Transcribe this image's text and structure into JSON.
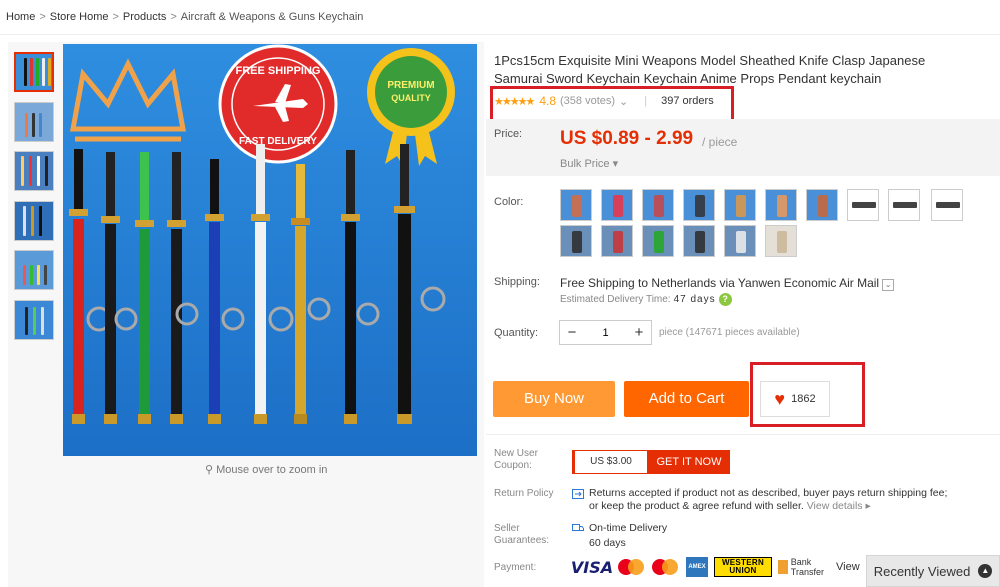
{
  "breadcrumb": [
    {
      "label": "Home"
    },
    {
      "label": "Store Home"
    },
    {
      "label": "Products"
    },
    {
      "label": "Aircraft & Weapons & Guns Keychain"
    }
  ],
  "breadcrumb_sep": ">",
  "gallery": {
    "thumbnail_count": 6,
    "zoom_hint": "Mouse over to zoom in",
    "image_badges": {
      "shipping_line1": "FREE SHIPPING",
      "shipping_line2": "FAST DELIVERY",
      "quality_line1": "PREMIUM",
      "quality_line2": "QUALITY"
    }
  },
  "product": {
    "title": "1Pcs15cm Exquisite Mini Weapons Model Sheathed Knife Clasp Japanese Samurai Sword Keychain Keychain Anime Props Pendant keychain",
    "stars": "★★★★★",
    "rating": "4.8",
    "votes": "(358 votes)",
    "votes_caret": "⌄",
    "orders": "397 orders"
  },
  "price": {
    "label": "Price:",
    "value": "US $0.89 - 2.99",
    "unit": "/ piece",
    "bulk": "Bulk Price ▾"
  },
  "color": {
    "label": "Color:",
    "swatch_count": 15
  },
  "shipping": {
    "label": "Shipping:",
    "line_prefix": "Free Shipping",
    "line_to": " to ",
    "country": "Netherlands",
    "line_via": " via Yanwen Economic Air Mail",
    "dropdown": "⌄",
    "est_label": "Estimated Delivery Time:",
    "est_value": "47 days",
    "help": "?"
  },
  "quantity": {
    "label": "Quantity:",
    "minus": "−",
    "value": "1",
    "plus": "+",
    "note": "piece (147671 pieces available)"
  },
  "actions": {
    "buy_now": "Buy Now",
    "add_to_cart": "Add to Cart",
    "wishlist_count": "1862",
    "heart": "♥"
  },
  "coupon": {
    "label": "New User Coupon:",
    "amount": "US $3.00",
    "button": "GET IT NOW"
  },
  "return_policy": {
    "label": "Return Policy",
    "text": "Returns accepted if product not as described, buyer pays return shipping fee; or keep the product & agree refund with seller.",
    "link": "View details ▸"
  },
  "seller_guarantees": {
    "label": "Seller Guarantees:",
    "line1": "On-time Delivery",
    "line2": "60 days"
  },
  "payment": {
    "label": "Payment:",
    "visa": "VISA",
    "amex": "AMEX",
    "western_union": "WESTERN UNION",
    "bank_transfer": "Bank Transfer",
    "more": "View"
  },
  "recently_viewed": {
    "label": "Recently Viewed",
    "arrow": "▲"
  },
  "colors": {
    "accent_red": "#e62e04",
    "buy_orange": "#ff9933",
    "cart_orange": "#ff6600",
    "star_orange": "#ff9e0d",
    "annotation_red": "#d81f26"
  }
}
